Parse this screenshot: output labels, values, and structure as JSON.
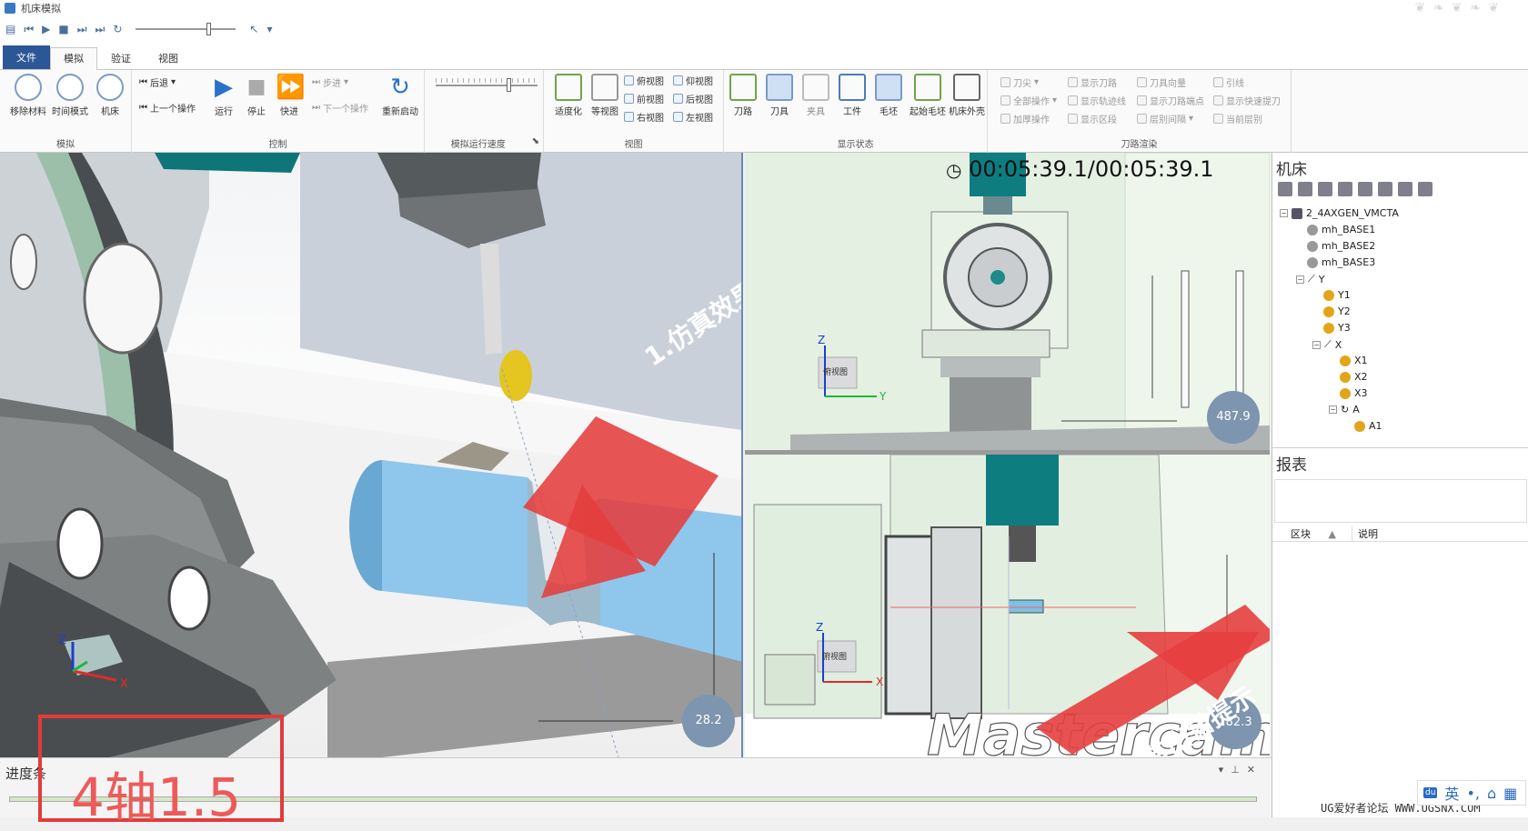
{
  "window": {
    "title": "机床模拟"
  },
  "ribbon_tabs": [
    {
      "label": "文件"
    },
    {
      "label": "模拟"
    },
    {
      "label": "验证"
    },
    {
      "label": "视图"
    }
  ],
  "groups": {
    "simulate": {
      "label": "模拟",
      "buttons": [
        {
          "label": "移除材料"
        },
        {
          "label": "时间模式"
        },
        {
          "label": "机床"
        }
      ]
    },
    "control": {
      "label": "控制",
      "back": "后退",
      "prev_op": "上一个操作",
      "run": "运行",
      "stop": "停止",
      "fast": "快进",
      "step": "步进",
      "next_op": "下一个操作",
      "restart": "重新启动"
    },
    "speed": {
      "label": "模拟运行速度"
    },
    "view": {
      "label": "视图",
      "fit": "适度化",
      "iso": "等视图",
      "items": [
        "俯视图",
        "仰视图",
        "前视图",
        "后视图",
        "右视图",
        "左视图"
      ]
    },
    "display": {
      "label": "显示状态",
      "buttons": [
        {
          "label": "刀路"
        },
        {
          "label": "刀具"
        },
        {
          "label": "夹具"
        },
        {
          "label": "工件"
        },
        {
          "label": "毛坯"
        },
        {
          "label": "起始毛坯"
        },
        {
          "label": "机床外壳"
        }
      ]
    },
    "toolpath": {
      "label": "刀路渲染",
      "items": [
        "刀尖",
        "显示刀路",
        "刀具向量",
        "引线",
        "全部操作",
        "显示轨迹线",
        "显示刀路端点",
        "显示快速提刀",
        "加厚操作",
        "显示区段",
        "层别间隔",
        "当前层别"
      ]
    }
  },
  "viewport": {
    "timer": "00:05:39.1/00:05:39.1",
    "annotation_1": "1.仿真效果",
    "annotation_2": "2.没有出错提示",
    "overlay_text": "4轴1.5",
    "dim_main": "28.2",
    "dim_top": "487.9",
    "dim_bottom": "282.3",
    "view_label": "俯视图",
    "axis_z": "Z",
    "axis_y": "Y",
    "axis_x": "X",
    "brand": "Mastercam"
  },
  "machine_panel": {
    "title": "机床",
    "tree": [
      {
        "label": "2_4AXGEN_VMCTA",
        "level": 0
      },
      {
        "label": "mh_BASE1",
        "level": 1
      },
      {
        "label": "mh_BASE2",
        "level": 1
      },
      {
        "label": "mh_BASE3",
        "level": 1
      },
      {
        "label": "Y",
        "level": 1
      },
      {
        "label": "Y1",
        "level": 2
      },
      {
        "label": "Y2",
        "level": 2
      },
      {
        "label": "Y3",
        "level": 2
      },
      {
        "label": "X",
        "level": 2
      },
      {
        "label": "X1",
        "level": 3
      },
      {
        "label": "X2",
        "level": 3
      },
      {
        "label": "X3",
        "level": 3
      },
      {
        "label": "A",
        "level": 3
      },
      {
        "label": "A1",
        "level": 4
      }
    ]
  },
  "report_panel": {
    "title": "报表",
    "col_block": "区块",
    "col_desc": "说明"
  },
  "progress": {
    "title": "进度条",
    "value": 1.0
  },
  "ime": {
    "label": "英"
  },
  "watermark": "UG爱好者论坛 WWW.UGSNX.COM"
}
